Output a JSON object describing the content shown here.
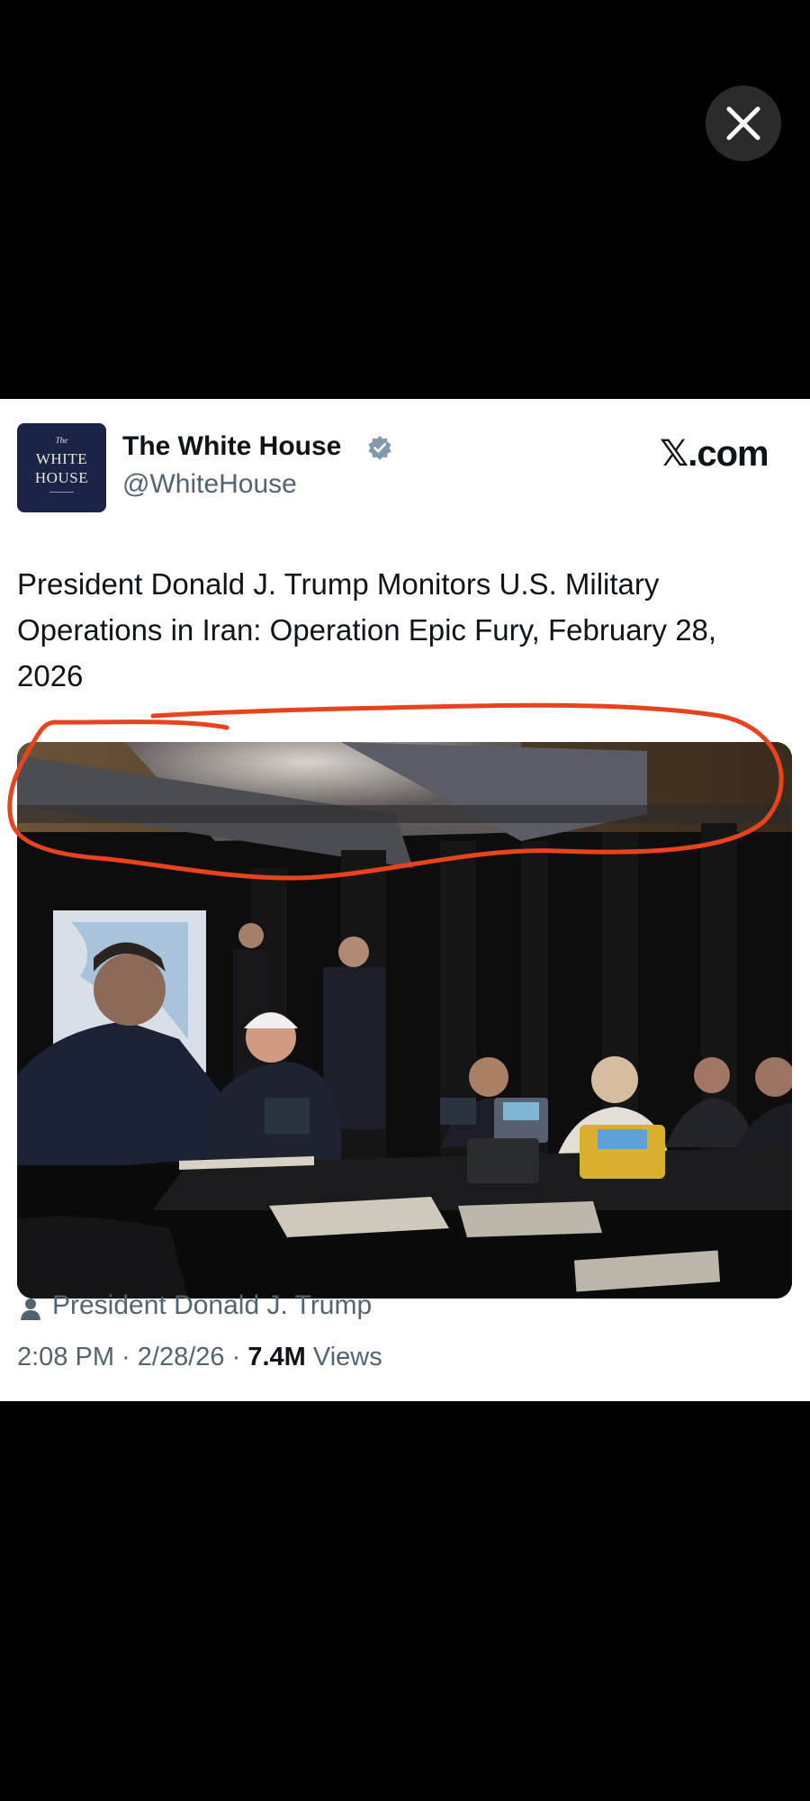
{
  "overlay": {
    "close_icon": "close-icon"
  },
  "card": {
    "avatar": {
      "small": "The",
      "line1": "WHITE",
      "line2": "HOUSE"
    },
    "display_name": "The White House",
    "verified_icon": "verified-badge-icon",
    "handle": "@WhiteHouse",
    "source_x": "𝕏",
    "source_rest": ".com",
    "text": "President Donald J. Trump Monitors U.S. Military Operations in Iran: Operation Epic Fury, February 28, 2026",
    "photo": {
      "description_icon": "photo",
      "annotation_color": "#e8431f"
    },
    "author_icon": "person-icon",
    "author": "President Donald J. Trump",
    "meta": {
      "time": "2:08 PM",
      "sep1": " · ",
      "date": "2/28/26",
      "sep2": " · ",
      "views_count": "7.4M",
      "views_label": " Views"
    }
  }
}
